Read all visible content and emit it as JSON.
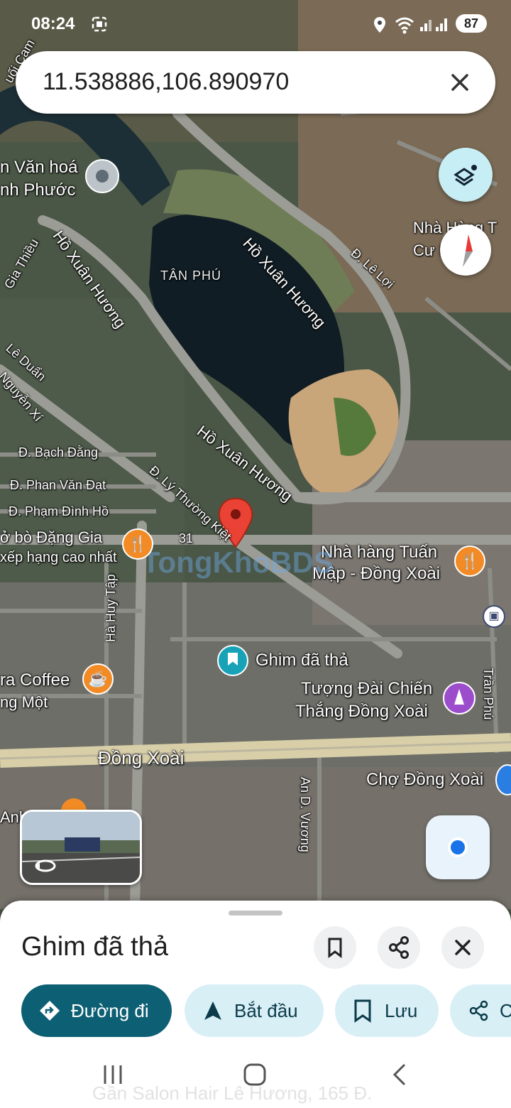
{
  "status_bar": {
    "time": "08:24",
    "battery": "87"
  },
  "search": {
    "query": "11.538886,106.890970"
  },
  "map": {
    "district": "TÂN PHÚ",
    "streets": [
      "Hồ Xuân Hương",
      "Hồ Xuân Hương",
      "Hồ Xuân Hương",
      "Đ. Lê Lợi",
      "Lê Duẩn",
      "Nguyễn Xí",
      "Đ. Bạch Đằng",
      "Đ. Phan Văn Đạt",
      "Đ. Phạm Đình Hồ",
      "Đ. Lý Thường Kiệt",
      "Hà Huy Tập",
      "Đồng Xoài",
      "An D. Vương",
      "Trần Phú",
      "31",
      "Gia Thiều"
    ],
    "pois": {
      "culture_center_1": "n Văn hoá",
      "culture_center_2": "nh Phước",
      "bank_1": "Nhà Hùng T",
      "bank_2": "Cư        Bă",
      "restaurant_left_1": "ở bò Đặng Gia",
      "restaurant_left_2": "xếp hạng cao nhất",
      "restaurant_right_1": "Nhà hàng Tuấn",
      "restaurant_right_2": "Mập - Đồng Xoài",
      "dropped_pin": "Ghim đã thả",
      "monument_1": "Tượng Đài Chiến",
      "monument_2": "Thắng Đồng Xoài",
      "coffee": "ra Coffee",
      "coffee_sub": "ng Một",
      "market": "Chợ Đồng Xoài",
      "anh": "Anh",
      "top_corner": "uối Cam"
    },
    "watermark": "TongKhoBDS"
  },
  "sheet": {
    "title": "Ghim đã thả",
    "directions": "Đường đi",
    "start": "Bắt đầu",
    "save": "Lưu",
    "share_partial": "C",
    "address_faded": "Gần Salon Hair Lê Hương, 165 Đ."
  },
  "colors": {
    "pin": "#ea4335",
    "primary": "#0d5f73",
    "chip": "#d8eff6",
    "poi_orange": "#f28b25",
    "poi_teal": "#17a2b8",
    "poi_purple": "#9c4dcc"
  }
}
